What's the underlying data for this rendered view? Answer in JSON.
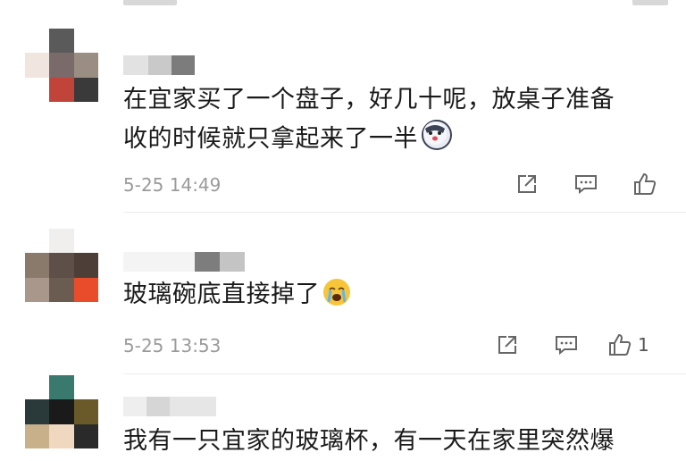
{
  "comments": [
    {
      "text_lines": [
        "在宜家买了一个盘子，好几十呢，放桌子准备",
        "收的时候就只拿起来了一半"
      ],
      "emoji": "husky-emoji",
      "time": "5-25 14:49",
      "likes": ""
    },
    {
      "text_lines": [
        "玻璃碗底直接掉了"
      ],
      "emoji": "crying-emoji",
      "time": "5-25 13:53",
      "likes": "1"
    },
    {
      "text_lines": [
        "我有一只宜家的玻璃杯，有一天在家里突然爆"
      ],
      "emoji": "",
      "time": "",
      "likes": ""
    }
  ],
  "icons": {
    "share": "share-icon",
    "reply": "comment-icon",
    "like": "thumbs-up-icon"
  },
  "colors": {
    "text": "#1a1a1a",
    "meta": "#9a9a9a",
    "icon": "#666666"
  }
}
